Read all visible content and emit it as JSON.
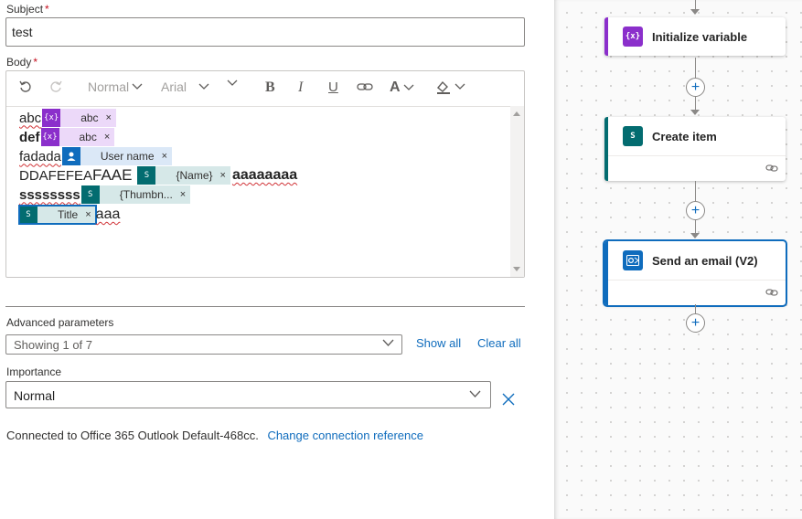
{
  "subject": {
    "label": "Subject",
    "required_mark": "*",
    "value": "test"
  },
  "body": {
    "label": "Body",
    "required_mark": "*",
    "toolbar": {
      "style": "Normal",
      "font": "Arial"
    },
    "lines": {
      "l1": {
        "text": "abc",
        "token": "abc"
      },
      "l2": {
        "text": "def",
        "token": "abc"
      },
      "l3": {
        "text": "fadada",
        "token": "User name"
      },
      "l4": {
        "text": "DDAFEFEA",
        "text_big": "FAAE",
        "token": "{Name}",
        "after": "aaaaaaaa"
      },
      "l5": {
        "text": "ssssssss",
        "token": "{Thumbn..."
      },
      "l6": {
        "token": "Title",
        "after": "aaa"
      }
    },
    "token_close": "×",
    "var_icon": "{x}",
    "sp_icon": "S"
  },
  "advanced": {
    "label": "Advanced parameters",
    "showing": "Showing 1 of 7",
    "show_all": "Show all",
    "clear_all": "Clear all"
  },
  "importance": {
    "label": "Importance",
    "value": "Normal"
  },
  "connection": {
    "text": "Connected to Office 365 Outlook Default-468cc.",
    "link": "Change connection reference"
  },
  "flow": {
    "cards": [
      {
        "title": "Initialize variable",
        "icon": "variable-icon",
        "color": "#8b2fcb"
      },
      {
        "title": "Create item",
        "icon": "sharepoint-icon",
        "color": "#036c70"
      },
      {
        "title": "Send an email (V2)",
        "icon": "outlook-icon",
        "color": "#0f6cbd"
      }
    ],
    "plus": "+"
  }
}
